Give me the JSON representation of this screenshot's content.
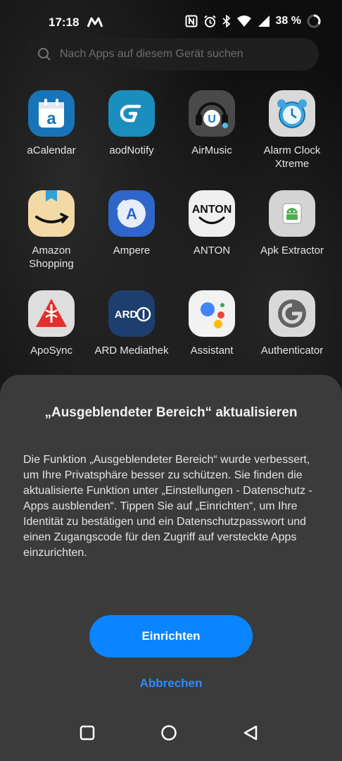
{
  "status_bar": {
    "time": "17:18",
    "battery_percent": "38 %"
  },
  "search": {
    "placeholder": "Nach Apps auf diesem Gerät suchen"
  },
  "apps": [
    {
      "label": "aCalendar",
      "icon": "calendar-icon"
    },
    {
      "label": "aodNotify",
      "icon": "notify-icon"
    },
    {
      "label": "AirMusic",
      "icon": "headphones-icon"
    },
    {
      "label": "Alarm Clock Xtreme",
      "icon": "alarm-clock-icon"
    },
    {
      "label": "Amazon Shopping",
      "icon": "amazon-icon"
    },
    {
      "label": "Ampere",
      "icon": "ampere-icon"
    },
    {
      "label": "ANTON",
      "icon": "anton-icon"
    },
    {
      "label": "Apk Extractor",
      "icon": "android-icon"
    },
    {
      "label": "ApoSync",
      "icon": "pharmacy-icon"
    },
    {
      "label": "ARD Mediathek",
      "icon": "ard-icon"
    },
    {
      "label": "Assistant",
      "icon": "assistant-icon"
    },
    {
      "label": "Authenticator",
      "icon": "authenticator-icon"
    }
  ],
  "icon_text": {
    "acalendar": "a",
    "ampere": "A",
    "anton": "ANTON",
    "ard": "ARD",
    "airmusic": "U"
  },
  "dialog": {
    "title": "„Ausgeblendeter Bereich“ aktualisieren",
    "body": "Die Funktion „Ausgeblendeter Bereich“ wurde verbessert, um Ihre Privatsphäre besser zu schützen. Sie finden die aktualisierte Funktion unter „Einstellungen - Datenschutz - Apps ausblenden“. Tippen Sie auf „Einrichten“, um Ihre Identität zu bestätigen und ein Datenschutzpasswort und einen Zugangscode für den Zugriff auf versteckte Apps einzurichten.",
    "primary_button": "Einrichten",
    "secondary_button": "Abbrechen"
  },
  "navigation": {
    "recents": "square-icon",
    "home": "circle-icon",
    "back": "triangle-icon"
  },
  "colors": {
    "accent": "#0a84ff",
    "sheet": "#3b3b3b"
  }
}
